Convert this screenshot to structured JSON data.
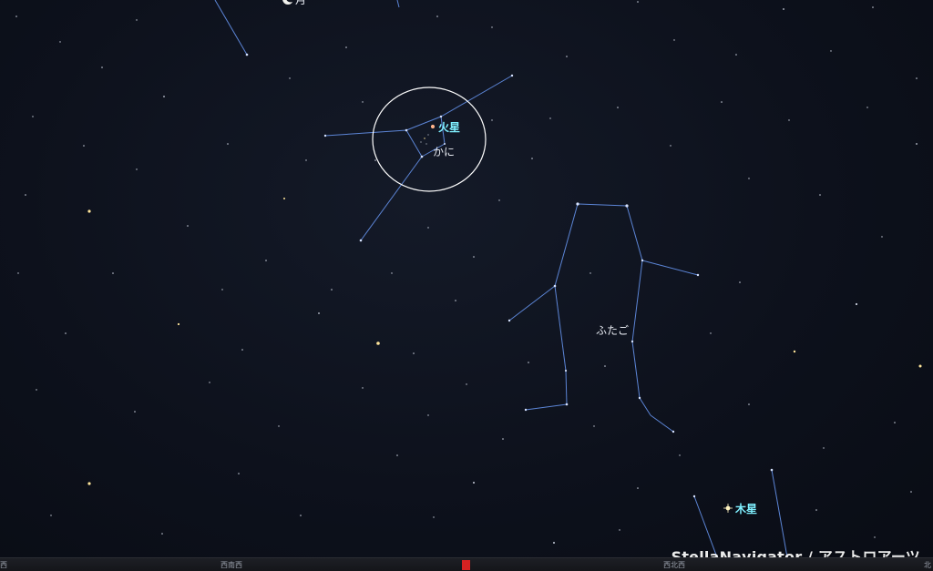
{
  "labels": {
    "moon": "月",
    "mars": "火星",
    "cancer": "かに",
    "gemini": "ふたご",
    "jupiter": "木星"
  },
  "watermark": "StellaNavigator / アストロアーツ",
  "directions": {
    "west": "西",
    "west_southwest": "西南西",
    "west_northwest": "西北西",
    "north": "北"
  },
  "colors": {
    "sky": "#0d111c",
    "constellation_line": "#5c85d6",
    "planet_label": "#7ff0ff",
    "constellation_label": "#e9ecf3",
    "highlight_circle": "#ffffff",
    "horizon_marker": "#d72222"
  },
  "icons": {
    "moon": "crescent-moon-icon",
    "planet": "planet-star-icon"
  }
}
